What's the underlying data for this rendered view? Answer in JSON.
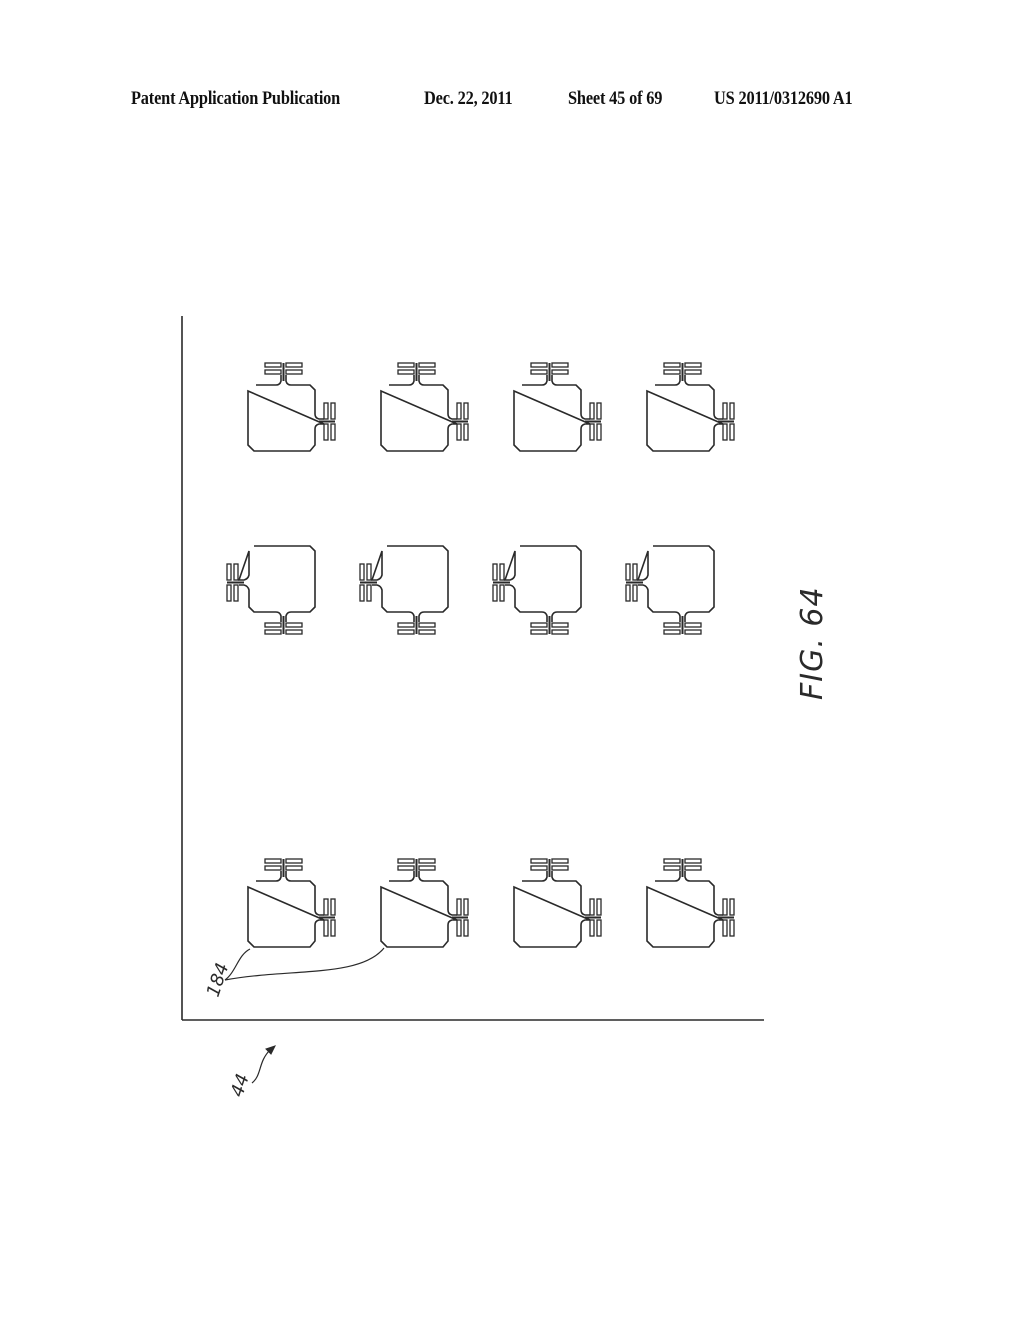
{
  "header": {
    "publication_label": "Patent Application Publication",
    "date": "Dec. 22, 2011",
    "sheet": "Sheet 45 of 69",
    "patent_number": "US 2011/0312690 A1"
  },
  "figure": {
    "label": "FIG. 64",
    "reference_numerals": {
      "loop_element": "184",
      "substrate": "44"
    },
    "grid": {
      "rows": [
        {
          "orientation": "antennas-top-right",
          "count": 4
        },
        {
          "orientation": "antennas-left-bottom",
          "count": 4
        },
        {
          "orientation": "antennas-top-right",
          "count": 4
        }
      ]
    },
    "line_color": "#2a2a2a"
  }
}
